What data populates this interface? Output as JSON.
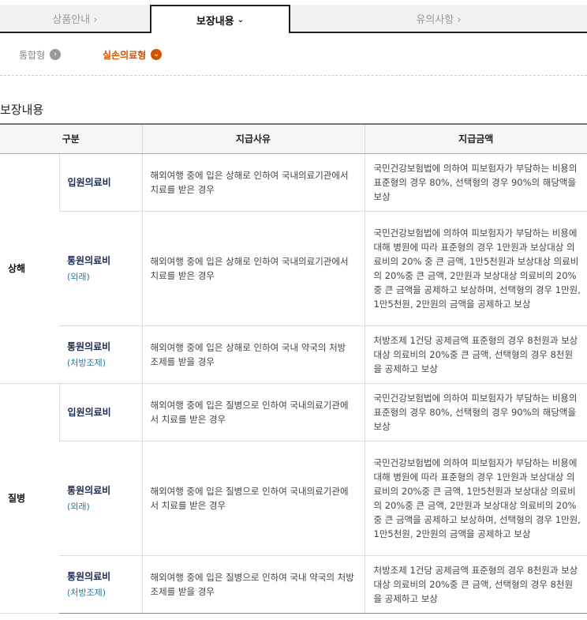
{
  "tabs": [
    {
      "label": "상품안내 ›"
    },
    {
      "label": "보장내용"
    },
    {
      "label": "유의사항 ›"
    }
  ],
  "subtabs": [
    {
      "label": "통합형",
      "icon": "chevron-right-icon"
    },
    {
      "label": "실손의료형",
      "icon": "chevron-down-icon"
    }
  ],
  "section_title": "보장내용",
  "table": {
    "headers": [
      "구분",
      "지급사유",
      "지급금액"
    ],
    "groups": [
      {
        "category": "상해",
        "rows": [
          {
            "item": "입원의료비",
            "sub": "",
            "reason": "해외여행 중에 입은 상해로 인하여 국내의료기관에서 치료를 받은 경우",
            "amount": "국민건강보험법에 의하여 피보험자가 부담하는 비용의 표준형의 경우 80%, 선택형의 경우 90%의 해당액을 보상"
          },
          {
            "item": "통원의료비",
            "sub": "(외래)",
            "reason": "해외여행 중에 입은 상해로 인하여 국내의료기관에서 치료를 받은 경우",
            "amount": "국민건강보험법에 의하여 피보험자가 부담하는 비용에 대해 병원에 따라 표준형의 경우 1만원과 보상대상 의료비의 20% 중 큰 금액, 1만5천원과 보상대상 의료비의 20%중 큰 금액, 2만원과 보상대상 의료비의 20%중 큰 금액을 공제하고 보상하며, 선택형의 경우 1만원, 1만5천원, 2만원의 금액을 공제하고 보상"
          },
          {
            "item": "통원의료비",
            "sub": "(처방조제)",
            "reason": "해외여행 중에 입은 상해로 인하여 국내 약국의 처방 조제를 받을 경우",
            "amount": "처방조제 1건당 공제금액 표준형의 경우 8천원과 보상대상 의료비의 20%중 큰 금액, 선택형의 경우 8천원을 공제하고 보상"
          }
        ]
      },
      {
        "category": "질병",
        "rows": [
          {
            "item": "입원의료비",
            "sub": "",
            "reason": "해외여행 중에 입은 질병으로 인하여 국내의료기관에서 치료를 받은 경우",
            "amount": "국민건강보험법에 의하여 피보험자가 부담하는 비용의 표준형의 경우 80%, 선택형의 경우 90%의 해당액을 보상"
          },
          {
            "item": "통원의료비",
            "sub": "(외래)",
            "reason": "해외여행 중에 입은 질병으로 인하여 국내의료기관에서 치료를 받은 경우",
            "amount": "국민건강보험법에 의하여 피보험자가 부담하는 비용에 대해 병원에 따라 표준형의 경우 1만원과 보상대상 의료비의 20%중 큰 금액, 1만5천원과 보상대상 의료비의 20%중 큰 금액, 2만원과 보상대상 의료비의 20%중 큰 금액을 공제하고 보상하며, 선택형의 경우 1만원, 1만5천원, 2만원의 금액을 공제하고 보상"
          },
          {
            "item": "통원의료비",
            "sub": "(처방조제)",
            "reason": "해외여행 중에 입은 질병으로 인하여 국내 약국의 처방 조제를 받을 경우",
            "amount": "처방조제 1건당 공제금액 표준형의 경우 8천원과 보상대상 의료비의 20%중 큰 금액, 선택형의 경우 8천원을 공제하고 보상"
          }
        ]
      }
    ]
  }
}
